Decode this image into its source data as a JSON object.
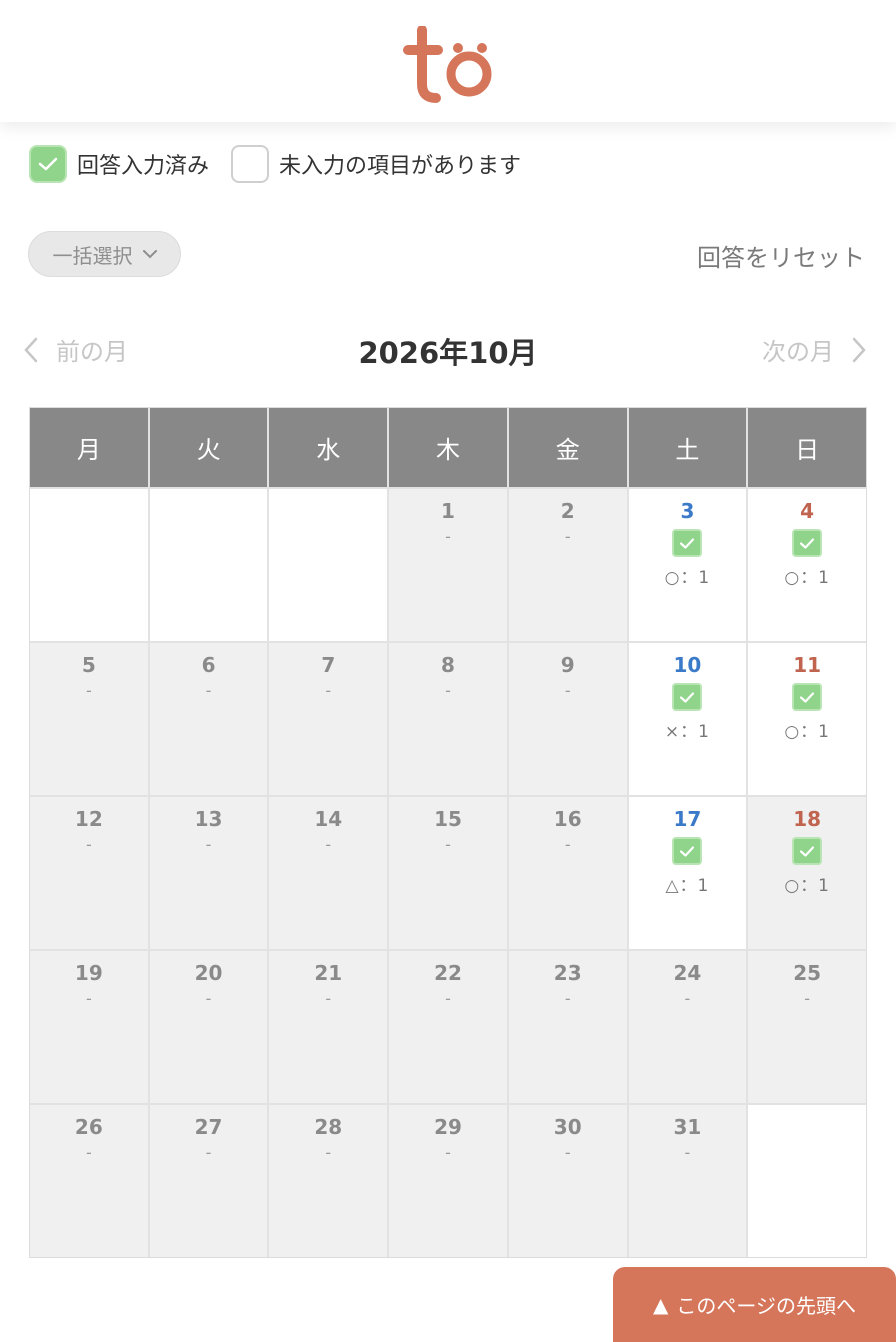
{
  "brand": {
    "logo_text": "tö",
    "accent": "#d5765b"
  },
  "legend": {
    "answered_label": "回答入力済み",
    "unanswered_label": "未入力の項目があります"
  },
  "toolbar": {
    "bulk_select_label": "一括選択",
    "reset_label": "回答をリセット"
  },
  "month_nav": {
    "prev_label": "前の月",
    "title": "2026年10月",
    "next_label": "次の月"
  },
  "calendar": {
    "weekdays": [
      "月",
      "火",
      "水",
      "木",
      "金",
      "土",
      "日"
    ],
    "cells": [
      {
        "blank": true
      },
      {
        "blank": true
      },
      {
        "blank": true
      },
      {
        "day": "1",
        "mark": "-"
      },
      {
        "day": "2",
        "mark": "-"
      },
      {
        "day": "3",
        "kind": "sat",
        "checked": true,
        "answer": "○：1"
      },
      {
        "day": "4",
        "kind": "sun",
        "checked": true,
        "answer": "○：1"
      },
      {
        "day": "5",
        "mark": "-"
      },
      {
        "day": "6",
        "mark": "-"
      },
      {
        "day": "7",
        "mark": "-"
      },
      {
        "day": "8",
        "mark": "-"
      },
      {
        "day": "9",
        "mark": "-"
      },
      {
        "day": "10",
        "kind": "sat",
        "checked": true,
        "answer": "×：1"
      },
      {
        "day": "11",
        "kind": "sun",
        "checked": true,
        "answer": "○：1"
      },
      {
        "day": "12",
        "mark": "-"
      },
      {
        "day": "13",
        "mark": "-"
      },
      {
        "day": "14",
        "mark": "-"
      },
      {
        "day": "15",
        "mark": "-"
      },
      {
        "day": "16",
        "mark": "-"
      },
      {
        "day": "17",
        "kind": "sat",
        "checked": true,
        "answer": "△：1"
      },
      {
        "day": "18",
        "kind": "sun",
        "checked": true,
        "answer": "○：1",
        "gray": true
      },
      {
        "day": "19",
        "mark": "-"
      },
      {
        "day": "20",
        "mark": "-"
      },
      {
        "day": "21",
        "mark": "-"
      },
      {
        "day": "22",
        "mark": "-"
      },
      {
        "day": "23",
        "mark": "-"
      },
      {
        "day": "24",
        "mark": "-"
      },
      {
        "day": "25",
        "mark": "-"
      },
      {
        "day": "26",
        "mark": "-"
      },
      {
        "day": "27",
        "mark": "-"
      },
      {
        "day": "28",
        "mark": "-"
      },
      {
        "day": "29",
        "mark": "-"
      },
      {
        "day": "30",
        "mark": "-"
      },
      {
        "day": "31",
        "mark": "-"
      },
      {
        "blank": true
      }
    ]
  },
  "back_to_top": {
    "label": "このページの先頭へ"
  }
}
